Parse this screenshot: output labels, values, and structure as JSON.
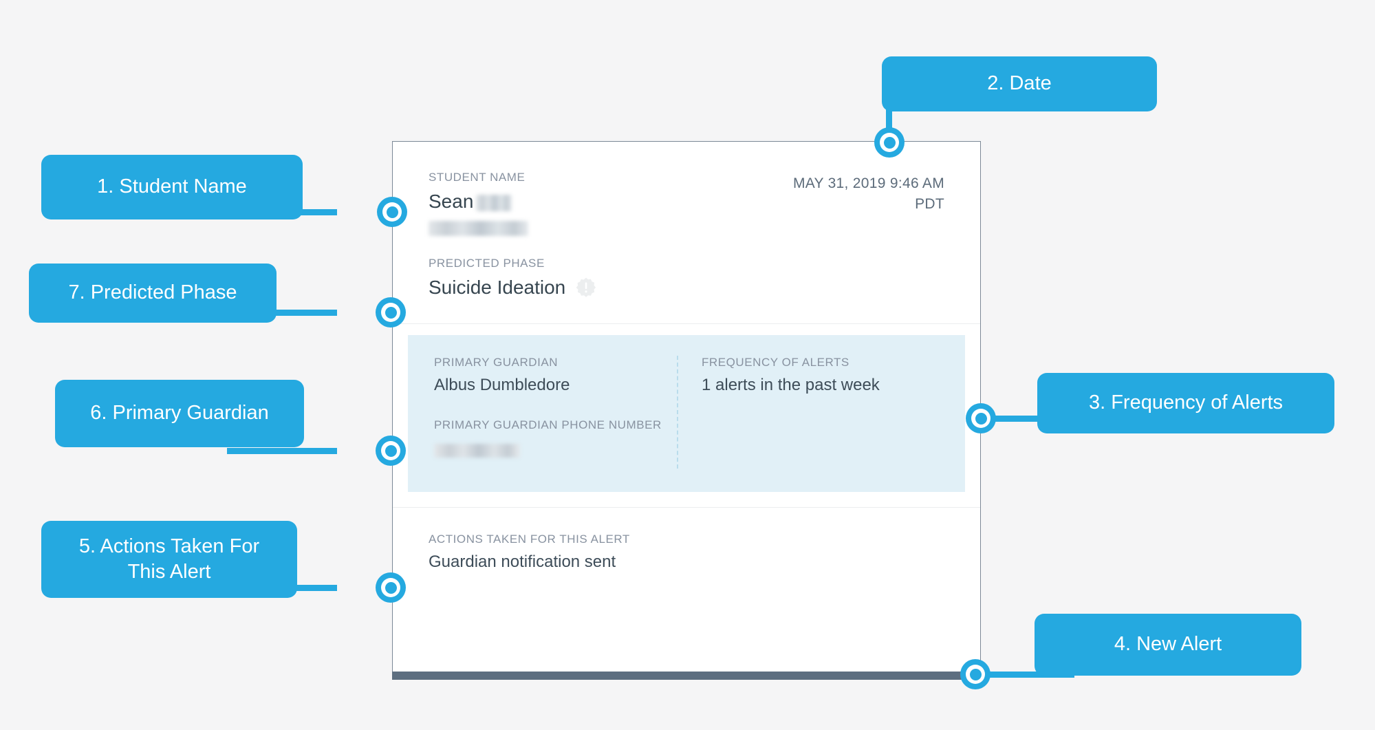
{
  "background_color": "#f5f5f6",
  "accent_color": "#25a9e0",
  "card": {
    "student_name_label": "STUDENT NAME",
    "student_name_value": "Sean",
    "date": "MAY 31, 2019 9:46 AM PDT",
    "predicted_phase_label": "PREDICTED PHASE",
    "predicted_phase_value": "Suicide Ideation",
    "phase_badge_icon": "alert-seal-icon",
    "primary_guardian_label": "PRIMARY GUARDIAN",
    "primary_guardian_value": "Albus Dumbledore",
    "primary_guardian_phone_label": "PRIMARY GUARDIAN PHONE NUMBER",
    "primary_guardian_phone_value": "",
    "frequency_label": "FREQUENCY OF ALERTS",
    "frequency_value": "1 alerts in the past week",
    "actions_label": "ACTIONS TAKEN FOR THIS ALERT",
    "actions_value": "Guardian notification sent"
  },
  "callouts": [
    {
      "id": "student-name",
      "label": "1. Student Name"
    },
    {
      "id": "date",
      "label": "2. Date"
    },
    {
      "id": "frequency",
      "label": "3. Frequency of Alerts"
    },
    {
      "id": "new-alert",
      "label": "4. New Alert"
    },
    {
      "id": "actions-taken",
      "label": "5. Actions Taken For\nThis Alert"
    },
    {
      "id": "guardian",
      "label": "6. Primary Guardian"
    },
    {
      "id": "phase",
      "label": "7. Predicted Phase"
    }
  ]
}
